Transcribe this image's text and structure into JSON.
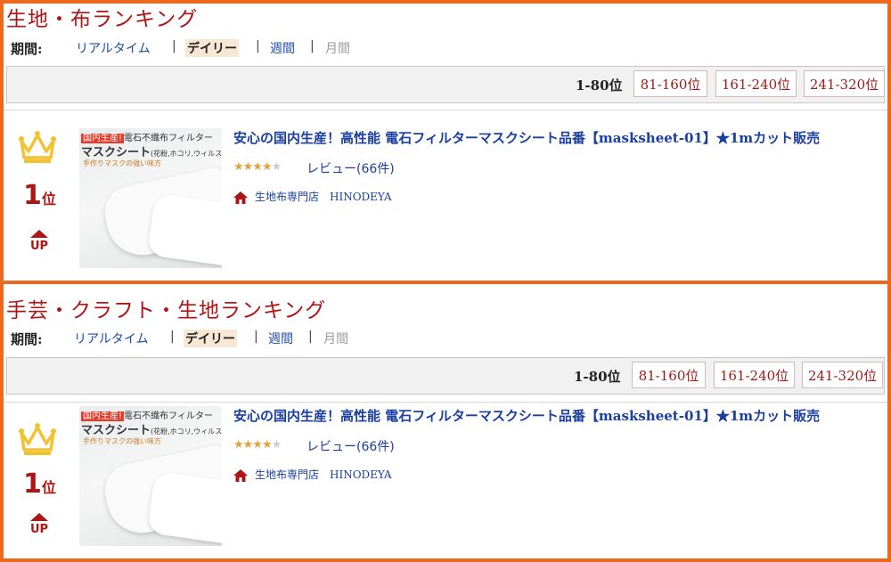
{
  "sections": [
    {
      "title": "生地・布ランキング",
      "period_label": "期間:",
      "period_options": [
        "リアルタイム",
        "デイリー",
        "週間",
        "月間"
      ],
      "pages": {
        "current": "1-80位",
        "links": [
          "81-160位",
          "161-240位",
          "241-320位"
        ]
      },
      "item": {
        "rank_number": "1",
        "rank_unit": "位",
        "rank_change": "UP",
        "image_text": {
          "tag": "国内生産!",
          "head": "電石不織布フィルター",
          "title": "マスクシート",
          "title_small": "(花粉,ホコリ,ウィルス)",
          "sub": "手作りマスクの強い味方"
        },
        "product_title": "安心の国内生産！高性能 電石フィルターマスクシート品番【masksheet-01】★1mカット販売",
        "stars": "★★★★",
        "half_star": "★",
        "review": "レビュー(66件)",
        "shop": "生地布専門店　HINODEYA"
      }
    },
    {
      "title": "手芸・クラフト・生地ランキング",
      "period_label": "期間:",
      "period_options": [
        "リアルタイム",
        "デイリー",
        "週間",
        "月間"
      ],
      "pages": {
        "current": "1-80位",
        "links": [
          "81-160位",
          "161-240位",
          "241-320位"
        ]
      },
      "item": {
        "rank_number": "1",
        "rank_unit": "位",
        "rank_change": "UP",
        "image_text": {
          "tag": "国内生産!",
          "head": "電石不織布フィルター",
          "title": "マスクシート",
          "title_small": "(花粉,ホコリ,ウィルス)",
          "sub": "手作りマスクの強い味方"
        },
        "product_title": "安心の国内生産！高性能 電石フィルターマスクシート品番【masksheet-01】★1mカット販売",
        "stars": "★★★★",
        "half_star": "★",
        "review": "レビュー(66件)",
        "shop": "生地布専門店　HINODEYA"
      }
    }
  ],
  "colors": {
    "accent": "#ec6a1f",
    "title_red": "#b01515",
    "link_blue": "#1a3fa0",
    "star": "#e6a23a",
    "crown": "#f2c230"
  },
  "icons": [
    "crown-icon",
    "up-arrow-icon",
    "home-icon",
    "star-icon"
  ]
}
